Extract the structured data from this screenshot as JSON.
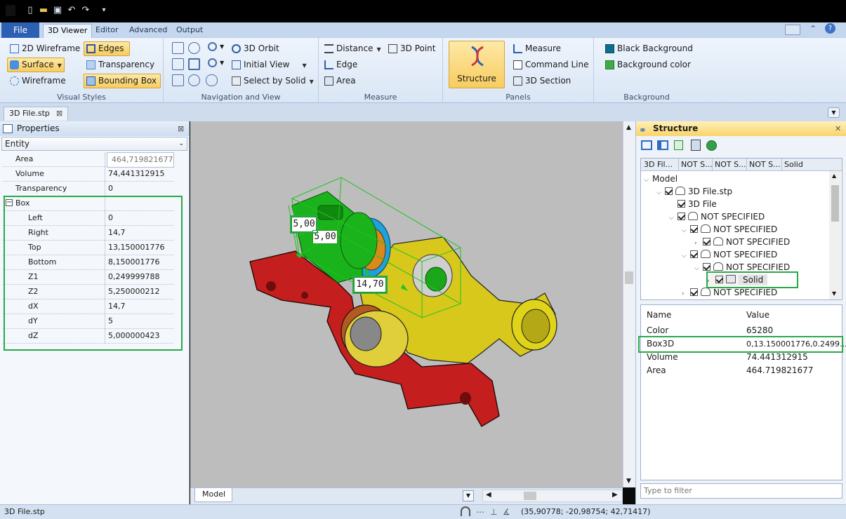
{
  "colors": {
    "accent": "#2b60b3",
    "highlight": "#2aa84a",
    "selected": "#f8cc60",
    "part_red": "#c41e1e",
    "part_yellow": "#d8c81c",
    "part_green": "#1bb31b"
  },
  "ribbon": {
    "file": "File",
    "tabs": [
      "3D Viewer",
      "Editor",
      "Advanced",
      "Output"
    ],
    "visual_styles": {
      "label": "Visual Styles",
      "items": [
        "2D Wireframe",
        "Surface",
        "Wireframe",
        "Edges",
        "Transparency",
        "Bounding Box"
      ]
    },
    "navigation": {
      "label": "Navigation and View",
      "orbit": "3D Orbit",
      "initial": "Initial View",
      "select": "Select by Solid"
    },
    "measure": {
      "label": "Measure",
      "distance": "Distance",
      "point": "3D Point",
      "edge": "Edge",
      "area": "Area"
    },
    "panels": {
      "label": "Panels",
      "structure": "Structure",
      "measure": "Measure",
      "command_line": "Command Line",
      "section": "3D Section"
    },
    "background": {
      "label": "Background",
      "black": "Black Background",
      "color": "Background color"
    }
  },
  "document_tab": "3D File.stp",
  "properties": {
    "title": "Properties",
    "entity": "Entity",
    "rows": [
      {
        "k": "Area",
        "v": "464,719821677"
      },
      {
        "k": "Volume",
        "v": "74,441312915"
      },
      {
        "k": "Transparency",
        "v": "0"
      }
    ],
    "box_label": "Box",
    "box": [
      {
        "k": "Left",
        "v": "0"
      },
      {
        "k": "Right",
        "v": "14,7"
      },
      {
        "k": "Top",
        "v": "13,150001776"
      },
      {
        "k": "Bottom",
        "v": "8,150001776"
      },
      {
        "k": "Z1",
        "v": "0,249999788"
      },
      {
        "k": "Z2",
        "v": "5,250000212"
      },
      {
        "k": "dX",
        "v": "14,7"
      },
      {
        "k": "dY",
        "v": "5"
      },
      {
        "k": "dZ",
        "v": "5,000000423"
      }
    ]
  },
  "viewport": {
    "dims": {
      "a": "5,00",
      "b": "5,00",
      "c": "14,70"
    },
    "tab": "Model"
  },
  "structure": {
    "title": "Structure",
    "columns": [
      "3D Fil...",
      "NOT S...",
      "NOT S...",
      "NOT S...",
      "Solid"
    ],
    "tree": [
      "Model",
      "3D File.stp",
      "3D File",
      "NOT SPECIFIED",
      "NOT SPECIFIED",
      "NOT SPECIFIED",
      "NOT SPECIFIED",
      "NOT SPECIFIED",
      "Solid",
      "NOT SPECIFIED"
    ],
    "grid_headers": {
      "name": "Name",
      "value": "Value"
    },
    "grid": [
      {
        "k": "Color",
        "v": "65280"
      },
      {
        "k": "Box3D",
        "v": "0,13.150001776,0.2499..."
      },
      {
        "k": "Volume",
        "v": "74.441312915"
      },
      {
        "k": "Area",
        "v": "464.719821677"
      }
    ],
    "filter_placeholder": "Type to filter"
  },
  "status": {
    "file": "3D File.stp",
    "coords": "(35,90778; -20,98754; 42,71417)"
  }
}
